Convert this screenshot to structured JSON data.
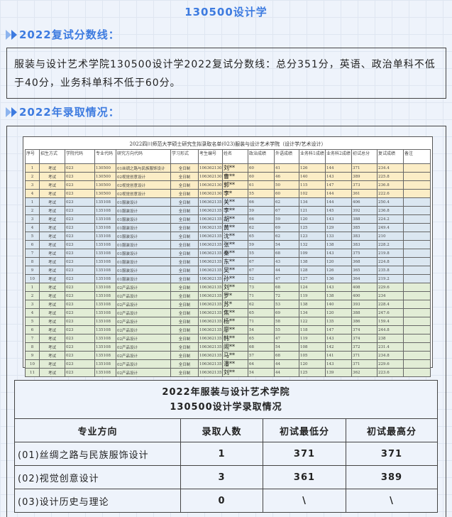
{
  "title": "130500设计学",
  "section1": {
    "heading": "2022复试分数线：",
    "text": "服装与设计艺术学院130500设计学2022复试分数线：总分351分，英语、政治单科不低于40分，业务科单科不低于60分。"
  },
  "section2": {
    "heading": "2022年录取情况："
  },
  "raw_table": {
    "title": "2022四川师范大学硕士研究生拟录取名单(023)服装与设计艺术学院（设计学/艺术设计）",
    "headers": [
      "序号",
      "招生方式",
      "学院代码",
      "专业代码",
      "研究方向代码",
      "学习形式",
      "考生编号",
      "姓名",
      "政治成绩",
      "外语成绩",
      "业务科1成绩",
      "业务科2成绩",
      "初试总分",
      "复试成绩",
      "备注"
    ],
    "rows": [
      [
        "1",
        "考试",
        "023",
        "130500",
        "01丝绸之路与民族服饰设计",
        "全日制",
        "10636213053…",
        "刘**",
        "60",
        "41",
        "126",
        "144",
        "371",
        "234.4",
        "",
        "y"
      ],
      [
        "2",
        "考试",
        "023",
        "130500",
        "02视觉创意设计",
        "全日制",
        "10636213053…",
        "曹**",
        "60",
        "46",
        "140",
        "143",
        "389",
        "225.8",
        "",
        "y"
      ],
      [
        "3",
        "考试",
        "023",
        "130500",
        "02视觉创意设计",
        "全日制",
        "10636213053…",
        "郭**",
        "61",
        "50",
        "115",
        "147",
        "373",
        "236.8",
        "",
        "y"
      ],
      [
        "4",
        "考试",
        "023",
        "130500",
        "02视觉创意设计",
        "全日制",
        "10636213053…",
        "李*",
        "55",
        "60",
        "102",
        "144",
        "361",
        "222.6",
        "",
        "y"
      ],
      [
        "1",
        "考试",
        "023",
        "135108",
        "01服装设计",
        "全日制",
        "10636213510…",
        "关**",
        "66",
        "62",
        "134",
        "144",
        "406",
        "250.4",
        "",
        "b"
      ],
      [
        "2",
        "考试",
        "023",
        "135108",
        "01服装设计",
        "全日制",
        "10636213510…",
        "李**",
        "59",
        "67",
        "121",
        "145",
        "392",
        "236.8",
        "",
        "b"
      ],
      [
        "3",
        "考试",
        "023",
        "135108",
        "01服装设计",
        "全日制",
        "10636213510…",
        "胡**",
        "66",
        "59",
        "120",
        "143",
        "388",
        "224.2",
        "",
        "b"
      ],
      [
        "4",
        "考试",
        "023",
        "135108",
        "01服装设计",
        "全日制",
        "10636213510…",
        "黄**",
        "62",
        "69",
        "125",
        "129",
        "385",
        "249.4",
        "",
        "b"
      ],
      [
        "5",
        "考试",
        "023",
        "135108",
        "01服装设计",
        "全日制",
        "10636213510…",
        "沈**",
        "65",
        "62",
        "123",
        "133",
        "383",
        "210",
        "",
        "b"
      ],
      [
        "6",
        "考试",
        "023",
        "135108",
        "01服装设计",
        "全日制",
        "10636213510…",
        "张**",
        "59",
        "54",
        "132",
        "138",
        "383",
        "228.2",
        "",
        "b"
      ],
      [
        "7",
        "考试",
        "023",
        "135108",
        "01服装设计",
        "全日制",
        "10636213510…",
        "秦**",
        "55",
        "68",
        "109",
        "143",
        "375",
        "219.8",
        "",
        "b"
      ],
      [
        "8",
        "考试",
        "023",
        "135108",
        "01服装设计",
        "全日制",
        "10636213510…",
        "东**",
        "67",
        "43",
        "138",
        "120",
        "368",
        "224.8",
        "",
        "b"
      ],
      [
        "9",
        "考试",
        "023",
        "135108",
        "01服装设计",
        "全日制",
        "10636213510…",
        "吴**",
        "67",
        "44",
        "128",
        "126",
        "365",
        "235.8",
        "",
        "b"
      ],
      [
        "10",
        "考试",
        "023",
        "135108",
        "01服装设计",
        "全日制",
        "10636213510…",
        "孙**",
        "52",
        "47",
        "127",
        "136",
        "364",
        "219.2",
        "",
        "b"
      ],
      [
        "1",
        "考试",
        "023",
        "135108",
        "02产品设计",
        "全日制",
        "10636213510…",
        "刘**",
        "73",
        "68",
        "124",
        "143",
        "408",
        "229.6",
        "",
        "g"
      ],
      [
        "2",
        "考试",
        "023",
        "135108",
        "02产品设计",
        "全日制",
        "10636213510…",
        "罗*",
        "71",
        "72",
        "119",
        "138",
        "400",
        "234",
        "",
        "g"
      ],
      [
        "3",
        "考试",
        "023",
        "135108",
        "02产品设计",
        "全日制",
        "10636213510…",
        "苏*",
        "62",
        "53",
        "138",
        "140",
        "393",
        "228.4",
        "",
        "g"
      ],
      [
        "4",
        "考试",
        "023",
        "135108",
        "02产品设计",
        "全日制",
        "10636213510…",
        "焦**",
        "65",
        "69",
        "134",
        "120",
        "388",
        "247.6",
        "",
        "g"
      ],
      [
        "5",
        "考试",
        "023",
        "135108",
        "02产品设计",
        "全日制",
        "10636213510…",
        "杨**",
        "71",
        "58",
        "122",
        "135",
        "386",
        "159.4",
        "",
        "g"
      ],
      [
        "6",
        "考试",
        "023",
        "135108",
        "02产品设计",
        "全日制",
        "10636213510…",
        "廖**",
        "54",
        "55",
        "118",
        "147",
        "374",
        "244.8",
        "",
        "g"
      ],
      [
        "7",
        "考试",
        "023",
        "135108",
        "02产品设计",
        "全日制",
        "10636213510…",
        "韩**",
        "65",
        "47",
        "119",
        "143",
        "374",
        "238",
        "",
        "g"
      ],
      [
        "8",
        "考试",
        "023",
        "135108",
        "02产品设计",
        "全日制",
        "10636213510…",
        "闹**",
        "68",
        "54",
        "108",
        "142",
        "372",
        "231.4",
        "",
        "g"
      ],
      [
        "9",
        "考试",
        "023",
        "135108",
        "02产品设计",
        "全日制",
        "10636213510…",
        "马**",
        "57",
        "68",
        "105",
        "141",
        "371",
        "234.8",
        "",
        "g"
      ],
      [
        "10",
        "考试",
        "023",
        "135108",
        "02产品设计",
        "全日制",
        "10636213510…",
        "潘**",
        "64",
        "44",
        "120",
        "143",
        "371",
        "229.6",
        "",
        "g"
      ],
      [
        "11",
        "考试",
        "023",
        "135108",
        "02产品设计",
        "全日制",
        "10636213510…",
        "刘**",
        "54",
        "44",
        "125",
        "139",
        "362",
        "223.6",
        "",
        "g"
      ]
    ]
  },
  "summary": {
    "title_line1": "2022年服装与设计艺术学院",
    "title_line2": "130500设计学录取情况",
    "headers": [
      "专业方向",
      "录取人数",
      "初试最低分",
      "初试最高分"
    ],
    "rows": [
      [
        "(01)丝绸之路与民族服饰设计",
        "1",
        "371",
        "371"
      ],
      [
        "(02)视觉创意设计",
        "3",
        "361",
        "389"
      ],
      [
        "(03)设计历史与理论",
        "0",
        "\\",
        "\\"
      ]
    ]
  },
  "colors": {
    "accent": "#3d7be0",
    "row_yellow": "#fbedc6",
    "row_blue": "#dbe7f1",
    "row_green": "#e2edd6"
  }
}
